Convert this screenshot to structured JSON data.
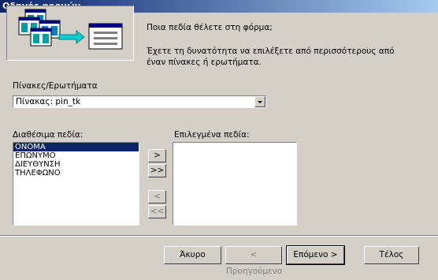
{
  "window": {
    "title": "Οδηγός φορμών"
  },
  "intro": {
    "question": "Ποια πεδία θέλετε στη φόρμα;",
    "hint": "Έχετε τη δυνατότητα να επιλέξετε από περισσότερους από έναν πίνακες ή ερωτήματα."
  },
  "tables": {
    "label": "Πίνακες/Ερωτήματα",
    "selected": "Πίνακας: pin_tk"
  },
  "available": {
    "label": "Διαθέσιμα πεδία:",
    "items": [
      "ΟΝΟΜΑ",
      "ΕΠΩΝΥΜΟ",
      "ΔΙΕΥΘΥΝΣΗ",
      "ΤΗΛΕΦΩΝΟ"
    ]
  },
  "selected_fields": {
    "label": "Επιλεγμένα πεδία:",
    "items": []
  },
  "move_buttons": {
    "add_one": ">",
    "add_all": ">>",
    "remove_one": "<",
    "remove_all": "<<"
  },
  "footer": {
    "cancel": "Άκυρο",
    "back": "< Προηγούμενο",
    "next": "Επόμενο >",
    "finish": "Τέλος"
  },
  "colors": {
    "titlebar": "#0a246a",
    "selection": "#0a246a",
    "face": "#d4d0c8"
  }
}
